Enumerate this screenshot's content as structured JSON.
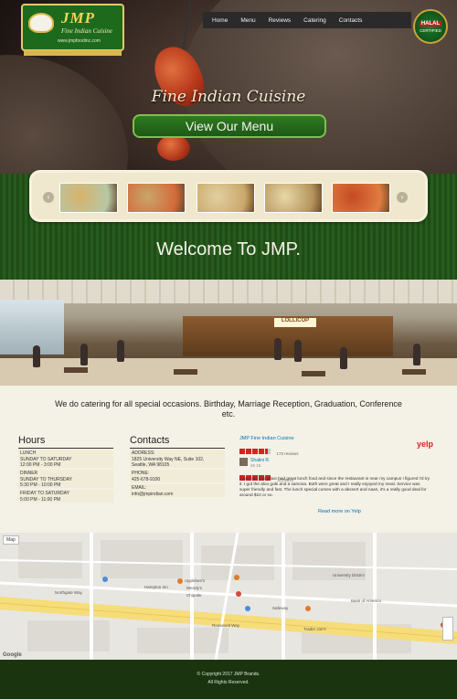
{
  "header": {
    "logo_name": "JMP",
    "logo_sub": "Fine Indian Cuisine",
    "logo_url": "www.jmpfoodinc.com",
    "halal_top": "HALAL",
    "halal_bottom": "CERTIFIED",
    "nav": [
      "Home",
      "Menu",
      "Reviews",
      "Catering",
      "Contacts"
    ]
  },
  "hero": {
    "tagline": "Fine Indian Cuisine",
    "menu_button": "View Our Menu"
  },
  "carousel": {
    "prev": "‹",
    "next": "›",
    "thumbs": [
      {
        "name": "dish-1",
        "colors": [
          "#d8b26b",
          "#b6c7a5"
        ]
      },
      {
        "name": "dish-2",
        "colors": [
          "#c9a66b",
          "#d46a3a"
        ]
      },
      {
        "name": "dish-3",
        "colors": [
          "#e2cfa0",
          "#c9a86a"
        ]
      },
      {
        "name": "dish-4",
        "colors": [
          "#e8d8a8",
          "#b6945c"
        ]
      },
      {
        "name": "dish-5",
        "colors": [
          "#c44a24",
          "#e07c3f"
        ]
      }
    ]
  },
  "welcome": "Welcome To JMP.",
  "panorama": {
    "sign": "LOLLICOP"
  },
  "catering_text": "We do catering for all special occasions. Birthday, Marriage Reception, Graduation, Conference etc.",
  "hours": {
    "title": "Hours",
    "lunch_label": "LUNCH",
    "lunch_days": "SUNDAY TO SATURDAY",
    "lunch_time": "12:00 PM - 3:00 PM",
    "dinner_label": "DINNER",
    "dinner_days": "SUNDAY TO THURSDAY",
    "dinner_time": "5:30 PM - 10:00 PM",
    "weekend_days": "FRIDAY TO SATURDAY",
    "weekend_time": "5:00 PM - 11:00 PM"
  },
  "contacts": {
    "title": "Contacts",
    "address_label": "ADDRESS:",
    "address": "1825 University Way NE, Suite 102,",
    "address2": "Seattle, WA 98105",
    "phone_label": "PHONE:",
    "phone": "425-678-9100",
    "email_label": "EMAIL:",
    "email": "info@jmpindian.com"
  },
  "yelp": {
    "business": "JMP Fine Indian Cuisine",
    "review_count": "173 reviews",
    "logo_text": "yelp",
    "reviewer": "Shalini R.",
    "reviewer_meta": "45   15",
    "review_date": "5/2/2018",
    "review": "I was told this place had great lunch food and since the restaurant is near my campus I figured I'd try it. I got the aloo gobi and a samosa. Both were great and I really enjoyed my meal. Service was super friendly and fast. The lunch special comes with a dessert and naan, it's a really good deal for around $10 or so.",
    "read_more": "Read more on Yelp"
  },
  "map": {
    "map_type": "Map",
    "labels": [
      "Hampton Inn",
      "University District",
      "Applebee's",
      "Wendy's",
      "Chipotle",
      "Bank of America",
      "Safeway",
      "Northgate Way",
      "Roosevelt Way",
      "Trader Joe's"
    ],
    "google": "Google"
  },
  "footer": {
    "copyright": "© Copyright 2017 JMP Brands.",
    "rights": "All Rights Reserved."
  }
}
